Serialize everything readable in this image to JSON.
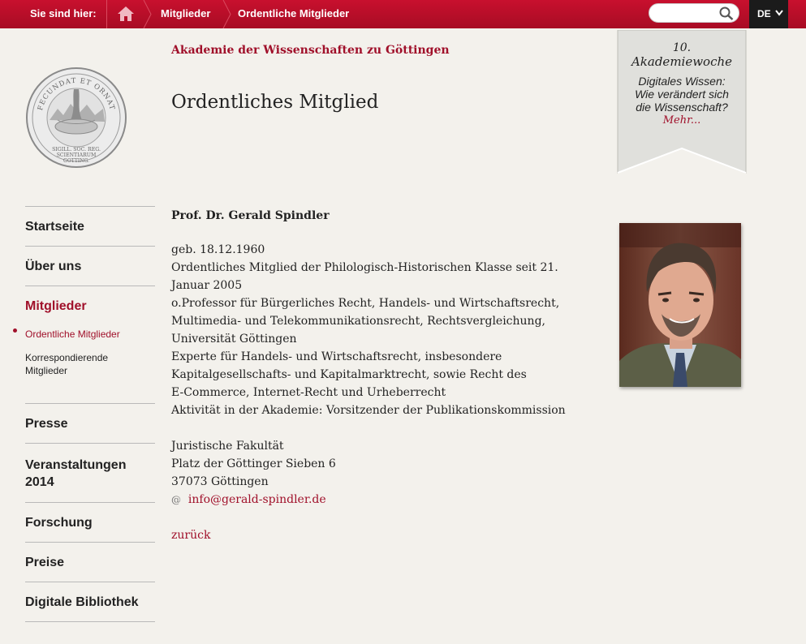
{
  "breadcrumb": {
    "label": "Sie sind hier:",
    "items": [
      "Mitglieder",
      "Ordentliche Mitglieder"
    ]
  },
  "search": {
    "placeholder": "",
    "value": ""
  },
  "language": "DE",
  "header": {
    "academy": "Akademie der Wissenschaften zu Göttingen",
    "page_title": "Ordentliches Mitglied"
  },
  "seal": {
    "text_top": "FECUNDAT ET ORNAT",
    "text_bottom": [
      "SIGILL. SOC. REG.",
      "SCIENTIARUM",
      "GOTTING."
    ]
  },
  "ribbon": {
    "number": "10.",
    "title": "Akademiewoche",
    "lines": [
      "Digitales Wissen:",
      "Wie verändert sich",
      "die Wissenschaft?"
    ],
    "more": "Mehr..."
  },
  "nav": {
    "items": [
      {
        "label": "Startseite"
      },
      {
        "label": "Über uns"
      },
      {
        "label": "Mitglieder",
        "active": true
      },
      {
        "label": "Presse"
      },
      {
        "label": "Veranstaltungen 2014"
      },
      {
        "label": "Forschung"
      },
      {
        "label": "Preise"
      },
      {
        "label": "Digitale Bibliothek"
      }
    ],
    "sub_items": [
      {
        "label": "Ordentliche Mitglieder",
        "active": true
      },
      {
        "label": "Korrespondierende Mitglieder"
      }
    ]
  },
  "member": {
    "name": "Prof. Dr. Gerald Spindler",
    "lines": [
      "geb. 18.12.1960",
      "Ordentliches Mitglied der Philologisch-Historischen Klasse seit 21.",
      "Januar 2005",
      "o.Professor für Bürgerliches Recht, Handels- und Wirtschaftsrecht,",
      "Multimedia- und Telekommunikationsrecht, Rechtsvergleichung,",
      "Universität Göttingen",
      "Experte für Handels- und Wirtschaftsrecht, insbesondere",
      "Kapitalgesellschafts- und Kapitalmarktrecht, sowie Recht des",
      "E-Commerce, Internet-Recht und Urheberrecht",
      "Aktivität in der Akademie: Vorsitzender der Publikationskommission"
    ],
    "address": [
      "Juristische Fakultät",
      "Platz der Göttinger Sieben 6",
      "37073 Göttingen"
    ],
    "email_prefix": "@",
    "email": "info@gerald-spindler.de",
    "back": "zurück"
  },
  "colors": {
    "brand": "#c8102e",
    "link": "#a0102a",
    "background": "#f3f1ec"
  }
}
